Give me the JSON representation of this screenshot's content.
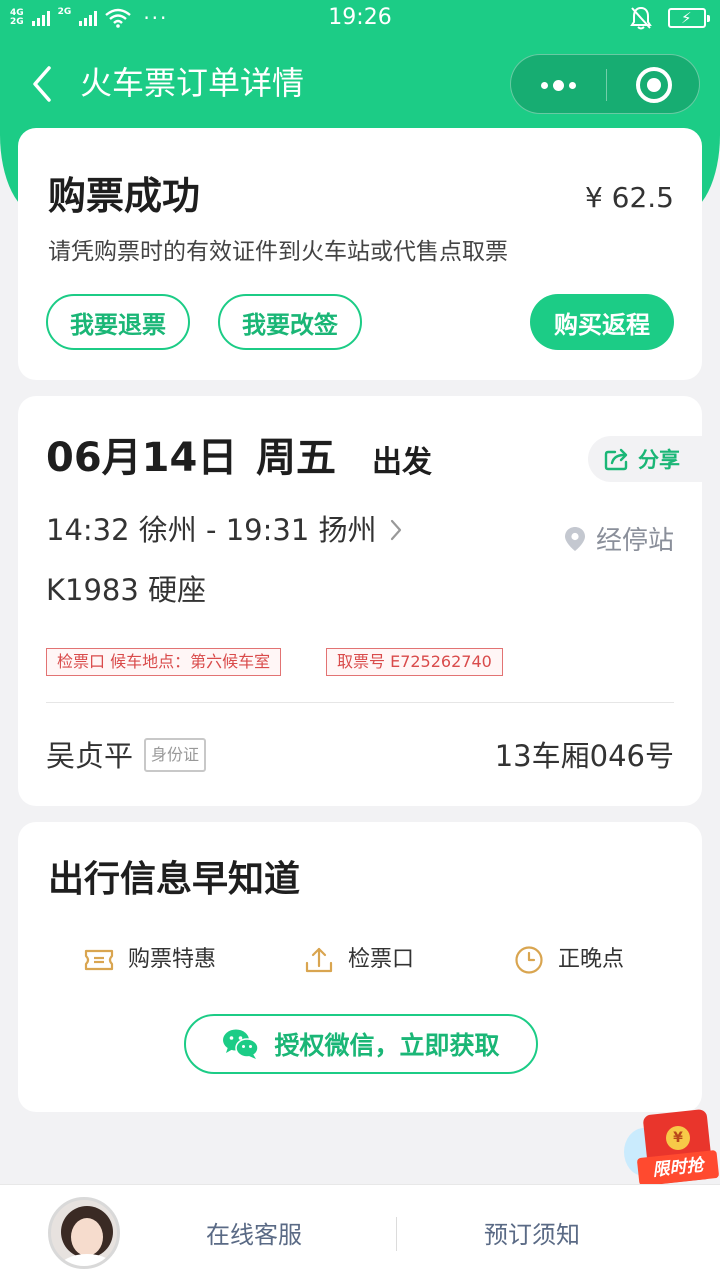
{
  "status_bar": {
    "network_top": "4G",
    "network_bottom": "2G",
    "network2": "2G",
    "more_dots": "···",
    "time": "19:26"
  },
  "nav": {
    "title": "火车票订单详情"
  },
  "order": {
    "status_title": "购票成功",
    "price": "¥ 62.5",
    "notice": "请凭购票时的有效证件到火车站或代售点取票",
    "refund_label": "我要退票",
    "change_label": "我要改签",
    "return_label": "购买返程"
  },
  "trip": {
    "date": "06月14日",
    "weekday": "周五",
    "depart_label": "出发",
    "share_label": "分享",
    "route": "14:32 徐州 - 19:31 扬州",
    "stops_label": "经停站",
    "train": "K1983  硬座",
    "gate_tag": "检票口 候车地点：第六候车室",
    "pickup_tag": "取票号 E725262740",
    "passenger_name": "吴贞平",
    "id_type": "身份证",
    "seat": "13车厢046号"
  },
  "travel_info": {
    "title": "出行信息早知道",
    "items": [
      {
        "label": "购票特惠",
        "icon": "ticket-icon"
      },
      {
        "label": "检票口",
        "icon": "upload-icon"
      },
      {
        "label": "正晚点",
        "icon": "clock-icon"
      }
    ],
    "auth_button": "授权微信，立即获取"
  },
  "promo": {
    "coin": "¥",
    "label": "限时抢"
  },
  "bottom_bar": {
    "service": "在线客服",
    "booking_notice": "预订须知"
  },
  "colors": {
    "brand_green": "#1ccc86",
    "tag_red": "#d94b4b",
    "icon_gold": "#d9a550"
  }
}
